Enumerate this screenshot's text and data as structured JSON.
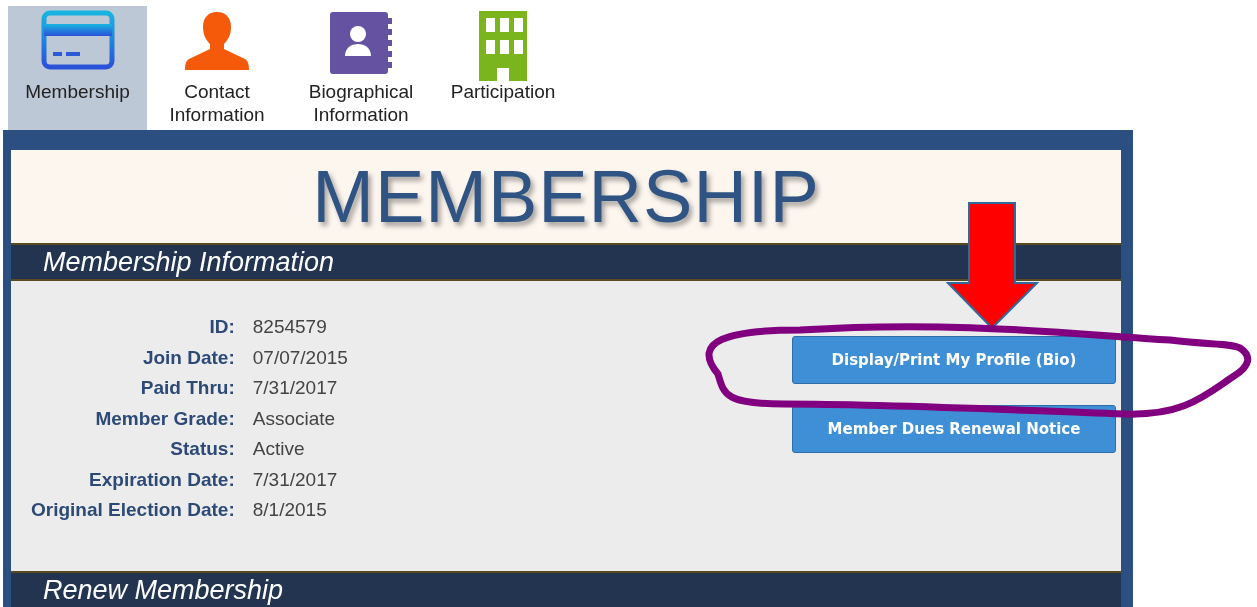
{
  "tabs": [
    {
      "label": "Membership",
      "selected": true
    },
    {
      "label": "Contact Information",
      "selected": false
    },
    {
      "label": "Biographical Information",
      "selected": false
    },
    {
      "label": "Participation",
      "selected": false
    }
  ],
  "banner": {
    "title": "MEMBERSHIP"
  },
  "section": {
    "title": "Membership Information",
    "fields": [
      {
        "label": "ID:",
        "value": "8254579"
      },
      {
        "label": "Join Date:",
        "value": "07/07/2015"
      },
      {
        "label": "Paid Thru:",
        "value": "7/31/2017"
      },
      {
        "label": "Member Grade:",
        "value": "Associate"
      },
      {
        "label": "Status:",
        "value": "Active"
      },
      {
        "label": "Expiration Date:",
        "value": "7/31/2017"
      },
      {
        "label": "Original Election Date:",
        "value": "8/1/2015"
      }
    ],
    "buttons": [
      "Display/Print My Profile (Bio)",
      "Member Dues Renewal Notice"
    ]
  },
  "next_section": {
    "title": "Renew Membership"
  },
  "annotations": [
    {
      "kind": "arrow"
    },
    {
      "kind": "loop"
    }
  ]
}
